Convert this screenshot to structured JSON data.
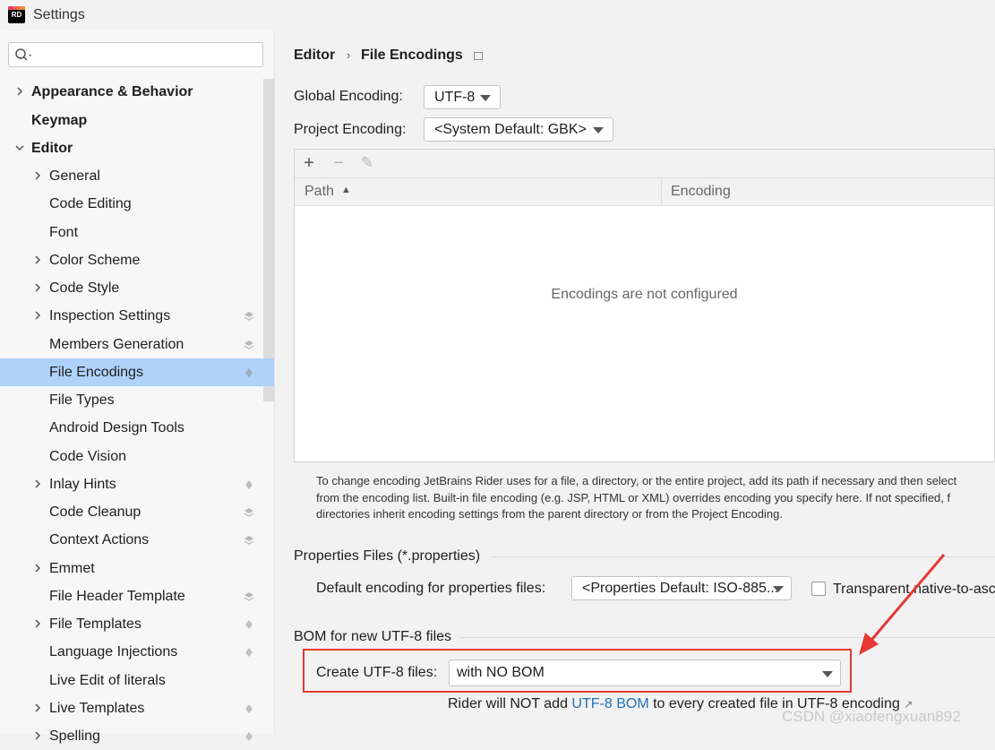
{
  "window": {
    "title": "Settings",
    "logo_text": "RD"
  },
  "sidebar": {
    "search_placeholder": "",
    "items": [
      {
        "label": "Appearance & Behavior"
      },
      {
        "label": "Keymap"
      },
      {
        "label": "Editor"
      },
      {
        "label": "General"
      },
      {
        "label": "Code Editing"
      },
      {
        "label": "Font"
      },
      {
        "label": "Color Scheme"
      },
      {
        "label": "Code Style"
      },
      {
        "label": "Inspection Settings"
      },
      {
        "label": "Members Generation"
      },
      {
        "label": "File Encodings"
      },
      {
        "label": "File Types"
      },
      {
        "label": "Android Design Tools"
      },
      {
        "label": "Code Vision"
      },
      {
        "label": "Inlay Hints"
      },
      {
        "label": "Code Cleanup"
      },
      {
        "label": "Context Actions"
      },
      {
        "label": "Emmet"
      },
      {
        "label": "File Header Template"
      },
      {
        "label": "File Templates"
      },
      {
        "label": "Language Injections"
      },
      {
        "label": "Live Edit of literals"
      },
      {
        "label": "Live Templates"
      },
      {
        "label": "Spelling"
      }
    ]
  },
  "breadcrumb": {
    "parent": "Editor",
    "separator": "›",
    "current": "File Encodings"
  },
  "global_encoding": {
    "label": "Global Encoding:",
    "value": "UTF-8"
  },
  "project_encoding": {
    "label": "Project Encoding:",
    "value": "<System Default: GBK>"
  },
  "table": {
    "add_label": "+",
    "remove_label": "−",
    "edit_label": "✎",
    "col_path": "Path",
    "col_path_sort": "▲",
    "col_encoding": "Encoding",
    "empty_text": "Encodings are not configured"
  },
  "help_text": {
    "line1": "To change encoding JetBrains Rider uses for a file, a directory, or the entire project, add its path if necessary and then select",
    "line2": "from the encoding list. Built-in file encoding (e.g. JSP, HTML or XML) overrides encoding you specify here. If not specified, f",
    "line3": "directories inherit encoding settings from the parent directory or from the Project Encoding."
  },
  "properties": {
    "section_title": "Properties Files (*.properties)",
    "default_label": "Default encoding for properties files:",
    "default_value": "<Properties Default: ISO-885...",
    "transparent_label": "Transparent native-to-asc",
    "transparent_checked": false
  },
  "bom": {
    "section_title": "BOM for new UTF-8 files",
    "create_label": "Create UTF-8 files:",
    "create_value": "with NO BOM",
    "note_prefix": "Rider will NOT add ",
    "note_link": "UTF-8 BOM",
    "note_suffix": " to every created file in UTF-8 encoding",
    "note_external": "↗"
  },
  "watermark": "CSDN @xiaofengxuan892",
  "colors": {
    "selection": "#aed2fa",
    "annotation": "#e53935",
    "link": "#2470b3"
  }
}
